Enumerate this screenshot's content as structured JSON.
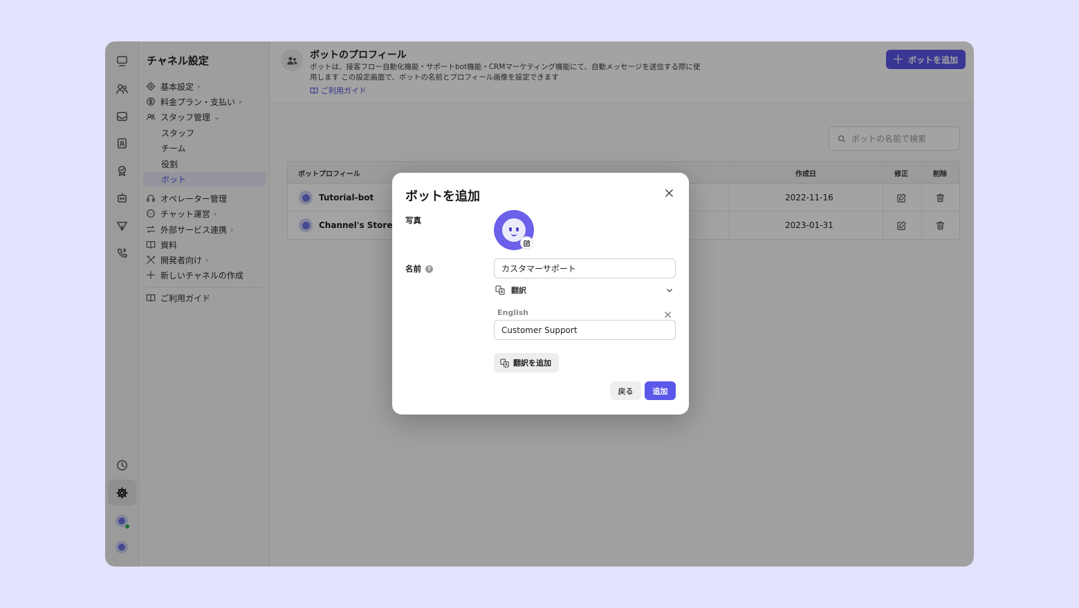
{
  "sidebar": {
    "title": "チャネル設定",
    "items": [
      {
        "label": "基本設定",
        "chevron": "›",
        "icon": "gear-icon"
      },
      {
        "label": "料金プラン・支払い",
        "chevron": "›",
        "icon": "coin-icon"
      },
      {
        "label": "スタッフ管理",
        "chevron": "⌄",
        "icon": "people-icon"
      },
      {
        "label": "スタッフ"
      },
      {
        "label": "チーム"
      },
      {
        "label": "役割"
      },
      {
        "label": "ボット"
      },
      {
        "label": "オペレーター管理",
        "icon": "headset-icon"
      },
      {
        "label": "チャット運営",
        "chevron": "›",
        "icon": "chat-icon"
      },
      {
        "label": "外部サービス連携",
        "chevron": "›",
        "icon": "arrows-icon"
      },
      {
        "label": "資料",
        "icon": "book-icon"
      },
      {
        "label": "開発者向け",
        "chevron": "›",
        "icon": "tools-icon"
      },
      {
        "label": "新しいチャネルの作成",
        "icon": "plus-icon"
      },
      {
        "label": "ご利用ガイド",
        "icon": "book-icon"
      }
    ]
  },
  "header": {
    "title": "ボットのプロフィール",
    "description": "ボットは、接客フロー自動化機能・サポートbot機能・CRMマーケティング機能にて、自動メッセージを送信する際に使用します この設定画面で、ボットの名前とプロフィール画像を設定できます",
    "guide_link": "ご利用ガイド",
    "add_button": "ボットを追加",
    "add_button_icon": "＋"
  },
  "search": {
    "placeholder": "ボットの名前で検索"
  },
  "table": {
    "columns": {
      "profile": "ボットプロフィール",
      "created": "作成日",
      "edit": "修正",
      "delete": "削除"
    },
    "rows": [
      {
        "name": "Tutorial-bot",
        "created": "2022-11-16"
      },
      {
        "name": "Channel's Store",
        "created": "2023-01-31"
      }
    ]
  },
  "modal": {
    "title": "ボットを追加",
    "photo_label": "写真",
    "name_label": "名前",
    "help_icon": "?",
    "name_value": "カスタマーサポート",
    "translate_label": "翻訳",
    "language": "English",
    "translation_value": "Customer Support",
    "add_translation": "翻訳を追加",
    "back_button": "戻る",
    "add_button": "追加"
  },
  "colors": {
    "accent": "#5b57e8",
    "background": "#e4e3fd",
    "online": "#2bb24c"
  }
}
